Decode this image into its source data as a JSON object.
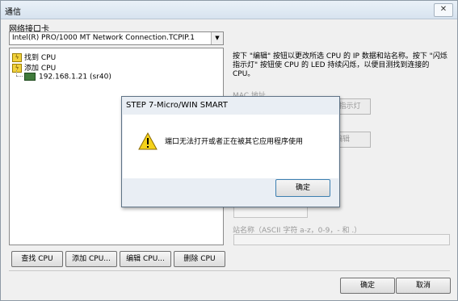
{
  "window": {
    "title": "通信"
  },
  "nic": {
    "label": "网络接口卡",
    "selected": "Intel(R) PRO/1000 MT Network Connection.TCPIP.1"
  },
  "tree": {
    "find_cpu": "找到 CPU",
    "add_cpu": "添加 CPU",
    "device": "192.168.1.21 (sr40)"
  },
  "info_text": "按下 \"编辑\" 按钮以更改所选 CPU 的 IP 数据和站名称。按下 \"闪烁指示灯\" 按钮使 CPU 的 LED 持续闪烁，以便目测找到连接的 CPU。",
  "right_panel": {
    "mac_label": "MAC 地址",
    "blink_button": "闪烁指示灯",
    "edit_button": "编辑",
    "station_label": "站名称（ASCII 字符 a-z，0-9，- 和 .）"
  },
  "bottom_buttons": {
    "find_cpu": "查找 CPU",
    "add_cpu": "添加 CPU...",
    "edit_cpu": "编辑 CPU...",
    "delete_cpu": "删除 CPU",
    "ok": "确定",
    "cancel": "取消"
  },
  "dialog": {
    "title": "STEP 7-Micro/WIN SMART",
    "message": "端口无法打开或者正在被其它应用程序使用",
    "ok": "确定"
  },
  "icons": {
    "close": "close-icon",
    "dropdown": "chevron-down-icon",
    "cpu_folder": "lightning-icon",
    "device": "plc-icon",
    "dialog": "warning-triangle-icon"
  }
}
